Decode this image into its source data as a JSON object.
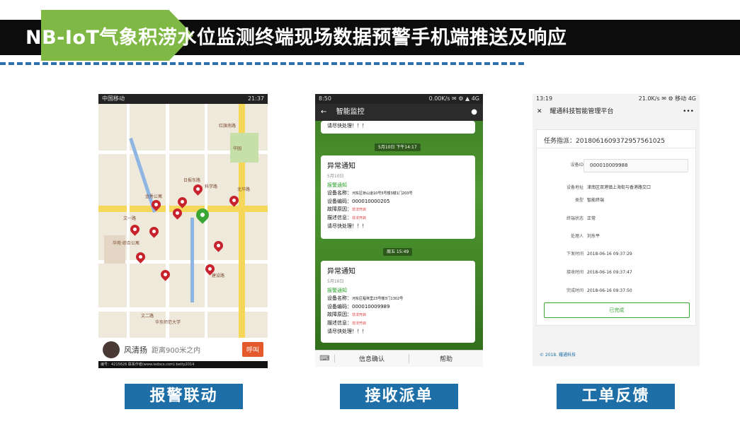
{
  "title": "NB-IoT气象积涝水位监测终端现场数据预警手机端推送及响应",
  "captions": {
    "c1": "报警联动",
    "c2": "接收派单",
    "c3": "工单反馈"
  },
  "phone1": {
    "status_left": "中国移动",
    "status_time": "21:37",
    "labels": [
      "华园",
      "红旗南路",
      "文一路",
      "文二路",
      "金秀公寓",
      "华苑·综合公寓",
      "华东师范大学",
      "科学路",
      "建设路",
      "日报东路",
      "北华路"
    ],
    "user_name": "风清扬",
    "distance": "距离900米之内",
    "call": "呼叫",
    "footer": "编号：4215626    联系作者(www.iedocx.com)    betty2014"
  },
  "phone2": {
    "status_left": "8:50",
    "status_right": "0.00K/s ✉ ⚙ ▲ 4G",
    "app_title": "智能监控",
    "top_tail": "请尽快处理！！！",
    "ts1": "5月10日 下午14:17",
    "ts2": "周五 15:49",
    "msg1": {
      "title": "异常通知",
      "date": "5月10日",
      "green": "报警通知",
      "name_label": "设备名称：",
      "name_value": "河东区桥山道10号5号楼3楼1门203号",
      "code_label": "设备编码：",
      "code_value": "000010000205",
      "fault_label": "故障原因：",
      "fault_value": "非法开启",
      "desc_label": "描述信息：",
      "desc_value": "非法开启",
      "tail": "请尽快处理！！！"
    },
    "msg2": {
      "title": "异常通知",
      "date": "5月16日",
      "green": "报警通知",
      "name_label": "设备名称：",
      "name_value": "河东区程林里23号楼3门1302号",
      "code_label": "设备编码：",
      "code_value": "000010009989",
      "fault_label": "故障原因：",
      "fault_value": "非法开启",
      "desc_label": "描述信息：",
      "desc_value": "非法开启",
      "tail": "请尽快处理！！！"
    },
    "btn_info": "信息确认",
    "btn_help": "帮助"
  },
  "phone3": {
    "status_left": "13:19",
    "status_right": "21.0K/s ✉ ⚙ 移动 4G",
    "platform": "耀通科技智能管理平台",
    "task_label": "任务指派：",
    "task_value": "20180616093729575610​25",
    "device_id_label": "设备ID",
    "device_id_value": "000010009988",
    "fields": [
      {
        "k": "设备地址",
        "v": "津南区双港镇上海街与香港路交口"
      },
      {
        "k": "类型",
        "v": "智能终端"
      },
      {
        "k": "终端状态",
        "v": "正常"
      },
      {
        "k": "处理人",
        "v": "刘东平"
      },
      {
        "k": "下发时间",
        "v": "2018-06-16 09:37:29"
      },
      {
        "k": "接收时间",
        "v": "2018-06-16 09:37:47"
      },
      {
        "k": "完成时间",
        "v": "2018-06-16 09:37:50"
      }
    ],
    "done": "已完成",
    "copyright": "© 2018. 耀通科技"
  }
}
